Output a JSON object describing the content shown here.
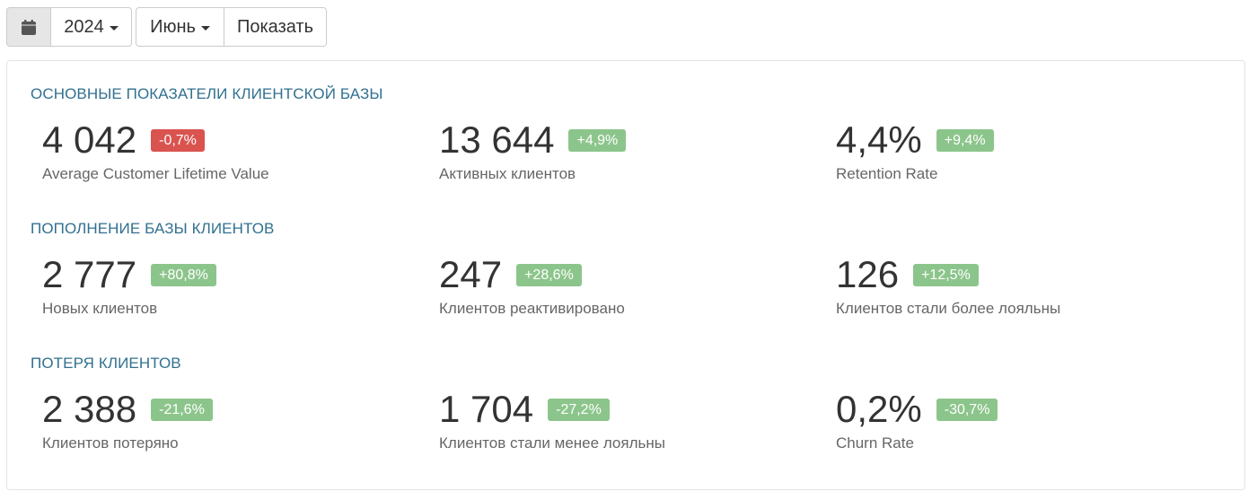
{
  "toolbar": {
    "calendar_icon": "calendar-icon",
    "year": "2024",
    "month": "Июнь",
    "show_label": "Показать"
  },
  "colors": {
    "section_title": "#31708f",
    "badge_negative": "#d9534f",
    "badge_positive": "#8cc58b"
  },
  "sections": [
    {
      "title": "ОСНОВНЫЕ ПОКАЗАТЕЛИ КЛИЕНТСКОЙ БАЗЫ",
      "stats": [
        {
          "value": "4 042",
          "change": "-0,7%",
          "label": "Average Customer Lifetime Value",
          "tone": "negative"
        },
        {
          "value": "13 644",
          "change": "+4,9%",
          "label": "Активных клиентов",
          "tone": "positive"
        },
        {
          "value": "4,4%",
          "change": "+9,4%",
          "label": "Retention Rate",
          "tone": "positive"
        }
      ]
    },
    {
      "title": "ПОПОЛНЕНИЕ БАЗЫ КЛИЕНТОВ",
      "stats": [
        {
          "value": "2 777",
          "change": "+80,8%",
          "label": "Новых клиентов",
          "tone": "positive"
        },
        {
          "value": "247",
          "change": "+28,6%",
          "label": "Клиентов реактивировано",
          "tone": "positive"
        },
        {
          "value": "126",
          "change": "+12,5%",
          "label": "Клиентов стали более лояльны",
          "tone": "positive"
        }
      ]
    },
    {
      "title": "ПОТЕРЯ КЛИЕНТОВ",
      "stats": [
        {
          "value": "2 388",
          "change": "-21,6%",
          "label": "Клиентов потеряно",
          "tone": "positive"
        },
        {
          "value": "1 704",
          "change": "-27,2%",
          "label": "Клиентов стали менее лояльны",
          "tone": "positive"
        },
        {
          "value": "0,2%",
          "change": "-30,7%",
          "label": "Churn Rate",
          "tone": "positive"
        }
      ]
    }
  ]
}
